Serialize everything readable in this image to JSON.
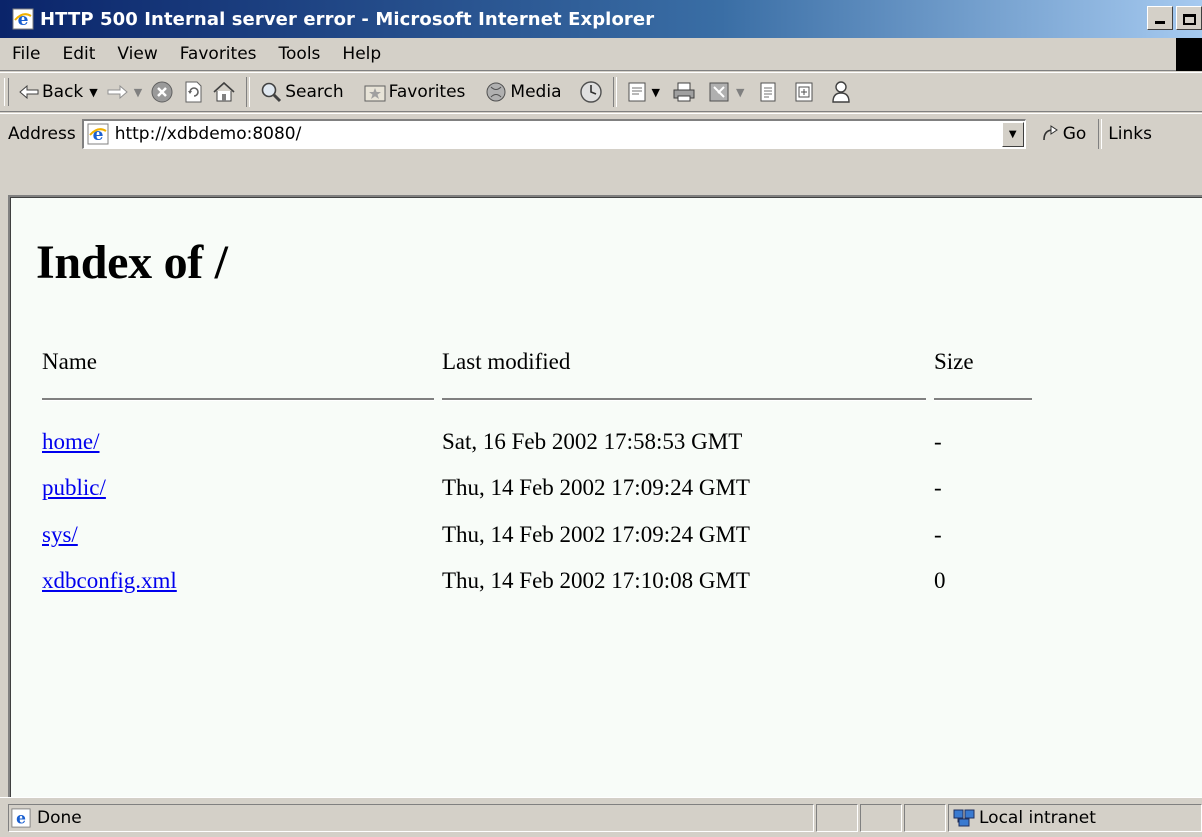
{
  "window": {
    "title": "HTTP 500 Internal server error - Microsoft Internet Explorer"
  },
  "menu": {
    "items": [
      "File",
      "Edit",
      "View",
      "Favorites",
      "Tools",
      "Help"
    ]
  },
  "toolbar": {
    "back_label": "Back",
    "search_label": "Search",
    "favorites_label": "Favorites",
    "media_label": "Media"
  },
  "address": {
    "label": "Address",
    "url": "http://xdbdemo:8080/",
    "go_label": "Go",
    "links_label": "Links"
  },
  "page": {
    "title": "Index of /",
    "columns": [
      "Name",
      "Last modified",
      "Size"
    ],
    "rows": [
      {
        "name": "home/",
        "modified": "Sat, 16 Feb 2002 17:58:53 GMT",
        "size": "-"
      },
      {
        "name": "public/",
        "modified": "Thu, 14 Feb 2002 17:09:24 GMT",
        "size": "-"
      },
      {
        "name": "sys/",
        "modified": "Thu, 14 Feb 2002 17:09:24 GMT",
        "size": "-"
      },
      {
        "name": "xdbconfig.xml",
        "modified": "Thu, 14 Feb 2002 17:10:08 GMT",
        "size": "0"
      }
    ]
  },
  "status": {
    "text": "Done",
    "zone": "Local intranet"
  },
  "colors": {
    "titlebar_start": "#0a246a",
    "titlebar_end": "#a6caf0",
    "chrome": "#d4d0c8",
    "link": "#0000ee",
    "page_bg": "#f8fcf8"
  },
  "icons": {
    "title": "ie-logo-icon",
    "back": "back-arrow-icon",
    "forward": "forward-arrow-icon",
    "stop": "stop-icon",
    "refresh": "refresh-icon",
    "home": "home-icon",
    "search": "search-icon",
    "favorites": "favorites-icon",
    "media": "media-icon",
    "history": "history-icon",
    "mail": "mail-icon",
    "print": "print-icon",
    "edit": "edit-icon",
    "discuss": "discuss-icon",
    "research": "research-icon",
    "messenger": "messenger-icon",
    "go": "go-arrow-icon",
    "page": "ie-page-icon",
    "zone": "local-intranet-icon"
  }
}
